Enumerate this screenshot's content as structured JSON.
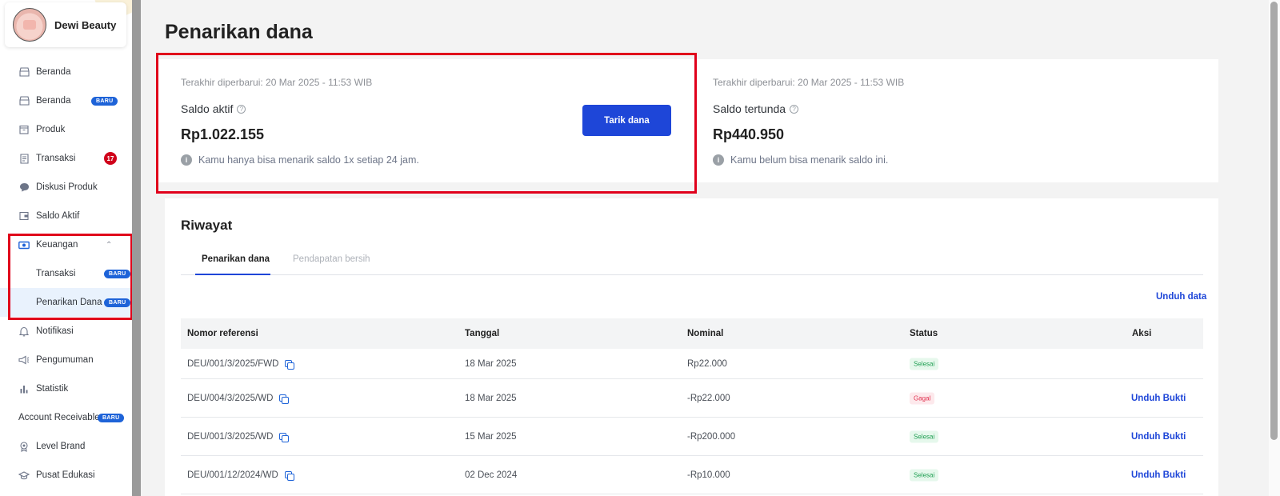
{
  "store": {
    "name": "Dewi Beauty"
  },
  "sidebar": {
    "items": [
      {
        "label": "Beranda",
        "icon": "store-icon"
      },
      {
        "label": "Beranda",
        "icon": "store-icon",
        "badge": "BARU"
      },
      {
        "label": "Produk",
        "icon": "box-icon"
      },
      {
        "label": "Transaksi",
        "icon": "receipt-icon",
        "count": "17"
      },
      {
        "label": "Diskusi Produk",
        "icon": "chat-icon"
      },
      {
        "label": "Saldo Aktif",
        "icon": "wallet-icon"
      },
      {
        "label": "Keuangan",
        "icon": "money-icon"
      },
      {
        "label": "Transaksi",
        "badge": "BARU"
      },
      {
        "label": "Penarikan Dana",
        "badge": "BARU"
      },
      {
        "label": "Notifikasi",
        "icon": "bell-icon"
      },
      {
        "label": "Pengumuman",
        "icon": "megaphone-icon"
      },
      {
        "label": "Statistik",
        "icon": "bar-chart-icon"
      },
      {
        "label": "Account Receivable",
        "badge": "BARU"
      },
      {
        "label": "Level Brand",
        "icon": "medal-icon"
      },
      {
        "label": "Pusat Edukasi",
        "icon": "graduation-cap-icon"
      }
    ]
  },
  "page": {
    "title": "Penarikan dana"
  },
  "active_balance": {
    "updated": "Terakhir diperbarui: 20 Mar 2025 - 11:53 WIB",
    "label": "Saldo aktif",
    "amount": "Rp1.022.155",
    "note": "Kamu hanya bisa menarik saldo 1x setiap 24 jam.",
    "button": "Tarik dana"
  },
  "pending_balance": {
    "updated": "Terakhir diperbarui: 20 Mar 2025 - 11:53 WIB",
    "label": "Saldo tertunda",
    "amount": "Rp440.950",
    "note": "Kamu belum bisa menarik saldo ini."
  },
  "history": {
    "title": "Riwayat",
    "tabs": [
      "Penarikan dana",
      "Pendapatan bersih"
    ],
    "download": "Unduh data",
    "columns": [
      "Nomor referensi",
      "Tanggal",
      "Nominal",
      "Status",
      "Aksi"
    ],
    "rows": [
      {
        "ref": "DEU/001/3/2025/FWD",
        "date": "18 Mar 2025",
        "amount": "Rp22.000",
        "status": "Selesai",
        "action": ""
      },
      {
        "ref": "DEU/004/3/2025/WD",
        "date": "18 Mar 2025",
        "amount": "-Rp22.000",
        "status": "Gagal",
        "action": "Unduh Bukti"
      },
      {
        "ref": "DEU/001/3/2025/WD",
        "date": "15 Mar 2025",
        "amount": "-Rp200.000",
        "status": "Selesai",
        "action": "Unduh Bukti"
      },
      {
        "ref": "DEU/001/12/2024/WD",
        "date": "02 Dec 2024",
        "amount": "-Rp10.000",
        "status": "Selesai",
        "action": "Unduh Bukti"
      }
    ]
  },
  "colors": {
    "primary": "#1e46d8",
    "badge": "#1e63d8",
    "highlight_border": "#e0001b",
    "success": "#1f9f52",
    "danger": "#e0314f"
  }
}
